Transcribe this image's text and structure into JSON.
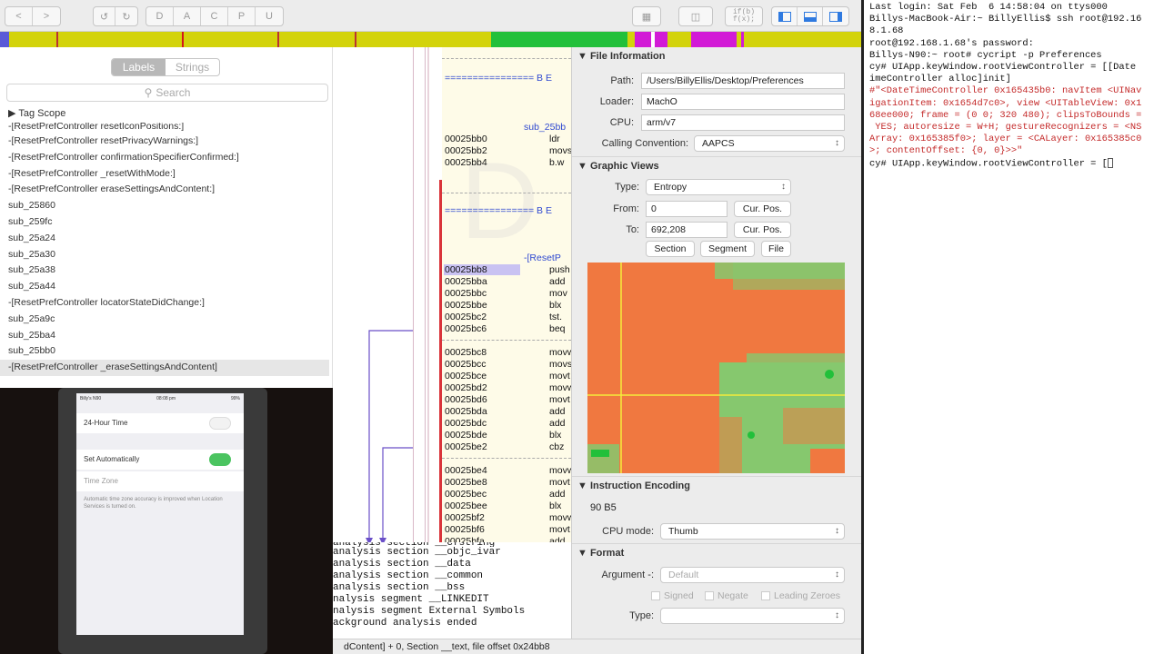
{
  "toolbar": {
    "nav_back": "<",
    "nav_forward": ">",
    "undo": "↺",
    "redo": "↻",
    "modes": [
      "D",
      "A",
      "C",
      "P",
      "U"
    ],
    "pseudocode_label": "if(b)\nf(x);"
  },
  "sidebar": {
    "tabs": [
      "Labels",
      "Strings"
    ],
    "active_tab": "Labels",
    "search_placeholder": "Search",
    "tag_scope": "Tag Scope",
    "items": [
      "-[ResetPrefController resetIconPositions:]",
      "-[ResetPrefController resetPrivacyWarnings:]",
      "-[ResetPrefController confirmationSpecifierConfirmed:]",
      "-[ResetPrefController _resetWithMode:]",
      "-[ResetPrefController eraseSettingsAndContent:]",
      "sub_25860",
      "sub_259fc",
      "sub_25a24",
      "sub_25a30",
      "sub_25a38",
      "sub_25a44",
      "-[ResetPrefController locatorStateDidChange:]",
      "sub_25a9c",
      "sub_25ba4",
      "sub_25bb0",
      "-[ResetPrefController _eraseSettingsAndContent]"
    ],
    "selected_index": 15
  },
  "phone": {
    "carrier": "Billy's N90",
    "time": "08:08 pm",
    "battery": "99%",
    "row_24h": "24-Hour Time",
    "row_auto": "Set Automatically",
    "row_tz": "Time Zone",
    "footer": "Automatic time zone accuracy is improved when Location Services is turned on."
  },
  "disasm": {
    "separator_1": "================ B E",
    "func_1": "sub_25bb",
    "separator_2": "================ B E",
    "func_2": "-[ResetP",
    "block_1": [
      {
        "addr": "00025bb0",
        "op": "ldr"
      },
      {
        "addr": "00025bb2",
        "op": "movs"
      },
      {
        "addr": "00025bb4",
        "op": "b.w"
      }
    ],
    "block_2": [
      {
        "addr": "00025bb8",
        "op": "push"
      },
      {
        "addr": "00025bba",
        "op": "add"
      },
      {
        "addr": "00025bbc",
        "op": "mov"
      },
      {
        "addr": "00025bbe",
        "op": "blx"
      },
      {
        "addr": "00025bc2",
        "op": "tst."
      },
      {
        "addr": "00025bc6",
        "op": "beq"
      }
    ],
    "block_3": [
      {
        "addr": "00025bc8",
        "op": "movw"
      },
      {
        "addr": "00025bcc",
        "op": "movs"
      },
      {
        "addr": "00025bce",
        "op": "movt"
      },
      {
        "addr": "00025bd2",
        "op": "movw"
      },
      {
        "addr": "00025bd6",
        "op": "movt"
      },
      {
        "addr": "00025bda",
        "op": "add"
      },
      {
        "addr": "00025bdc",
        "op": "add"
      },
      {
        "addr": "00025bde",
        "op": "blx"
      },
      {
        "addr": "00025be2",
        "op": "cbz"
      }
    ],
    "block_4": [
      {
        "addr": "00025be4",
        "op": "movw"
      },
      {
        "addr": "00025be8",
        "op": "movt"
      },
      {
        "addr": "00025bec",
        "op": "add"
      },
      {
        "addr": "00025bee",
        "op": "blx"
      },
      {
        "addr": "00025bf2",
        "op": "movw"
      },
      {
        "addr": "00025bf6",
        "op": "movt"
      },
      {
        "addr": "00025bfa",
        "op": "add"
      }
    ]
  },
  "console_lines": [
    "  analysis section __objc_ivar",
    "  analysis section __data",
    "  analysis section __common",
    "  analysis section __bss",
    "nalysis segment __LINKEDIT",
    "nalysis segment External Symbols",
    "ackground analysis ended"
  ],
  "status_text": "dContent] + 0, Section __text, file offset 0x24bb8",
  "file_info": {
    "title": "File Information",
    "path_label": "Path:",
    "path": "/Users/BillyEllis/Desktop/Preferences",
    "loader_label": "Loader:",
    "loader": "MachO",
    "cpu_label": "CPU:",
    "cpu": "arm/v7",
    "cc_label": "Calling Convention:",
    "cc": "AAPCS"
  },
  "graphic_views": {
    "title": "Graphic Views",
    "type_label": "Type:",
    "type": "Entropy",
    "from_label": "From:",
    "from": "0",
    "to_label": "To:",
    "to": "692,208",
    "cur_pos": "Cur. Pos.",
    "section_btn": "Section",
    "segment_btn": "Segment",
    "file_btn": "File"
  },
  "instruction_encoding": {
    "title": "Instruction Encoding",
    "bytes": "90 B5",
    "cpu_mode_label": "CPU mode:",
    "cpu_mode": "Thumb"
  },
  "format": {
    "title": "Format",
    "argument_label": "Argument -:",
    "argument": "Default",
    "signed": "Signed",
    "negate": "Negate",
    "leading_zeroes": "Leading Zeroes",
    "type_label": "Type:"
  },
  "terminal_lines": [
    {
      "t": "Last login: Sat Feb  6 14:58:04 on ttys000",
      "c": ""
    },
    {
      "t": "Billys-MacBook-Air:~ BillyEllis$ ssh root@192.16",
      "c": ""
    },
    {
      "t": "8.1.68",
      "c": ""
    },
    {
      "t": "root@192.168.1.68's password:",
      "c": ""
    },
    {
      "t": "Billys-N90:~ root# cycript -p Preferences",
      "c": ""
    },
    {
      "t": "cy# UIApp.keyWindow.rootViewController = [[Date",
      "c": ""
    },
    {
      "t": "imeController alloc]init]",
      "c": ""
    },
    {
      "t": "#\"<DateTimeController 0x165435b0: navItem <UINav",
      "c": "red"
    },
    {
      "t": "igationItem: 0x1654d7c0>, view <UITableView: 0x1",
      "c": "red"
    },
    {
      "t": "68ee000; frame = (0 0; 320 480); clipsToBounds =",
      "c": "red"
    },
    {
      "t": " YES; autoresize = W+H; gestureRecognizers = <NS",
      "c": "red"
    },
    {
      "t": "Array: 0x165385f0>; layer = <CALayer: 0x165385c0",
      "c": "red"
    },
    {
      "t": ">; contentOffset: {0, 0}>>\"",
      "c": "red"
    },
    {
      "t": "cy# UIApp.keyWindow.rootViewController = [",
      "c": ""
    }
  ],
  "colors": {
    "nav_yellow": "#d3d30b",
    "nav_green": "#22c03a",
    "nav_magenta": "#d21ad6",
    "entropy_orange": "#f07840",
    "entropy_green": "#86c86e",
    "terminal_red": "#c42a2a",
    "selection": "#c9c2f2"
  }
}
